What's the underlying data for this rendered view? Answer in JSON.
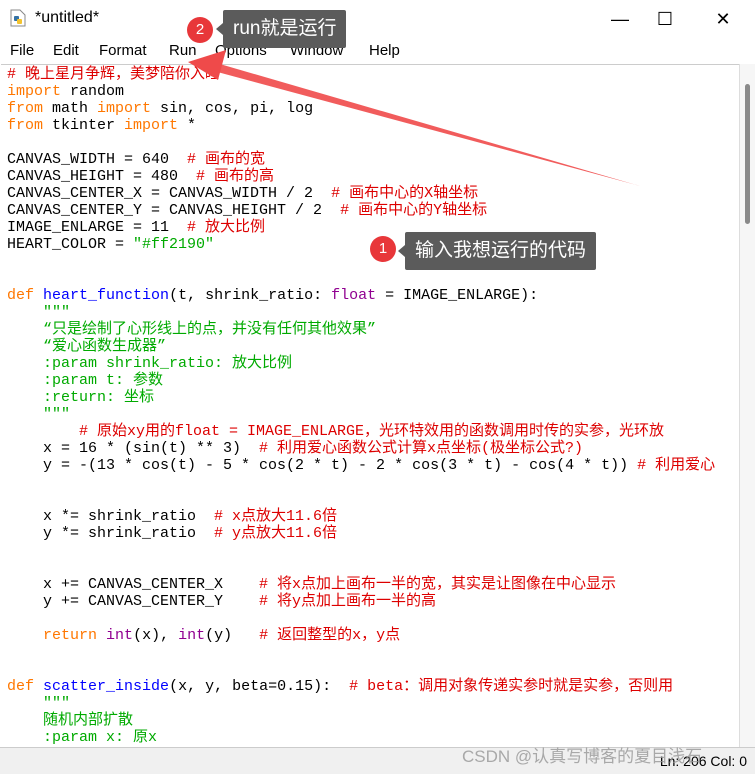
{
  "window": {
    "title": "*untitled*",
    "minimize": "—",
    "maximize": "☐",
    "close": "✕"
  },
  "menu": [
    "File",
    "Edit",
    "Format",
    "Run",
    "Options",
    "Window",
    "Help"
  ],
  "code_lines": [
    [
      [
        "# 晚上星月争辉，美梦陪你入睡",
        "c"
      ]
    ],
    [
      [
        "import",
        "k"
      ],
      [
        " random",
        "n"
      ]
    ],
    [
      [
        "from",
        "k"
      ],
      [
        " math ",
        "n"
      ],
      [
        "import",
        "k"
      ],
      [
        " sin, cos, pi, log",
        "n"
      ]
    ],
    [
      [
        "from",
        "k"
      ],
      [
        " tkinter ",
        "n"
      ],
      [
        "import",
        "k"
      ],
      [
        " *",
        "n"
      ]
    ],
    [],
    [
      [
        "CANVAS_WIDTH = 640  ",
        "n"
      ],
      [
        "# 画布的宽",
        "c"
      ]
    ],
    [
      [
        "CANVAS_HEIGHT = 480  ",
        "n"
      ],
      [
        "# 画布的高",
        "c"
      ]
    ],
    [
      [
        "CANVAS_CENTER_X = CANVAS_WIDTH / 2  ",
        "n"
      ],
      [
        "# 画布中心的X轴坐标",
        "c"
      ]
    ],
    [
      [
        "CANVAS_CENTER_Y = CANVAS_HEIGHT / 2  ",
        "n"
      ],
      [
        "# 画布中心的Y轴坐标",
        "c"
      ]
    ],
    [
      [
        "IMAGE_ENLARGE = 11  ",
        "n"
      ],
      [
        "# 放大比例",
        "c"
      ]
    ],
    [
      [
        "HEART_COLOR = ",
        "n"
      ],
      [
        "\"#ff2190\"",
        "s"
      ]
    ],
    [],
    [],
    [
      [
        "def",
        "k"
      ],
      [
        " ",
        "n"
      ],
      [
        "heart_function",
        "d"
      ],
      [
        "(t, shrink_ratio: ",
        "n"
      ],
      [
        "float",
        "b"
      ],
      [
        " = IMAGE_ENLARGE):",
        "n"
      ]
    ],
    [
      [
        "    \"\"\"",
        "s"
      ]
    ],
    [
      [
        "    “只是绘制了心形线上的点，并没有任何其他效果”",
        "s"
      ]
    ],
    [
      [
        "    “爱心函数生成器”",
        "s"
      ]
    ],
    [
      [
        "    :param shrink_ratio: 放大比例",
        "s"
      ]
    ],
    [
      [
        "    :param t: 参数",
        "s"
      ]
    ],
    [
      [
        "    :return: 坐标",
        "s"
      ]
    ],
    [
      [
        "    \"\"\"",
        "s"
      ]
    ],
    [
      [
        "        # 原始xy用的float = IMAGE_ENLARGE，光环特效用的函数调用时传的实参，光环放",
        "c"
      ]
    ],
    [
      [
        "    x = 16 * (sin(t) ** 3)  ",
        "n"
      ],
      [
        "# 利用爱心函数公式计算x点坐标(极坐标公式?)",
        "c"
      ]
    ],
    [
      [
        "    y = -(13 * cos(t) - 5 * cos(2 * t) - 2 * cos(3 * t) - cos(4 * t)) ",
        "n"
      ],
      [
        "# 利用爱心",
        "c"
      ]
    ],
    [],
    [],
    [
      [
        "    x *= shrink_ratio  ",
        "n"
      ],
      [
        "# x点放大11.6倍",
        "c"
      ]
    ],
    [
      [
        "    y *= shrink_ratio  ",
        "n"
      ],
      [
        "# y点放大11.6倍",
        "c"
      ]
    ],
    [],
    [],
    [
      [
        "    x += CANVAS_CENTER_X    ",
        "n"
      ],
      [
        "# 将x点加上画布一半的宽，其实是让图像在中心显示",
        "c"
      ]
    ],
    [
      [
        "    y += CANVAS_CENTER_Y    ",
        "n"
      ],
      [
        "# 将y点加上画布一半的高",
        "c"
      ]
    ],
    [],
    [
      [
        "    ",
        "n"
      ],
      [
        "return",
        "k"
      ],
      [
        " ",
        "n"
      ],
      [
        "int",
        "b"
      ],
      [
        "(x), ",
        "n"
      ],
      [
        "int",
        "b"
      ],
      [
        "(y)   ",
        "n"
      ],
      [
        "# 返回整型的x，y点",
        "c"
      ]
    ],
    [],
    [],
    [
      [
        "def",
        "k"
      ],
      [
        " ",
        "n"
      ],
      [
        "scatter_inside",
        "d"
      ],
      [
        "(x, y, beta=0.15):  ",
        "n"
      ],
      [
        "# beta：调用对象传递实参时就是实参，否则用",
        "c"
      ]
    ],
    [
      [
        "    \"\"\"",
        "s"
      ]
    ],
    [
      [
        "    随机内部扩散",
        "s"
      ]
    ],
    [
      [
        "    :param x: 原x",
        "s"
      ]
    ]
  ],
  "status": {
    "position": "Ln: 206  Col: 0"
  },
  "watermark": "CSDN @认真写博客的夏目浅石",
  "annotations": [
    {
      "number": "2",
      "text": "run就是运行"
    },
    {
      "number": "1",
      "text": "输入我想运行的代码"
    }
  ],
  "colors": {
    "keyword": "#ff7700",
    "builtin": "#900090",
    "definition": "#0000ff",
    "string": "#00aa00",
    "comment": "#dd0000",
    "annotation": "#e8373a"
  }
}
